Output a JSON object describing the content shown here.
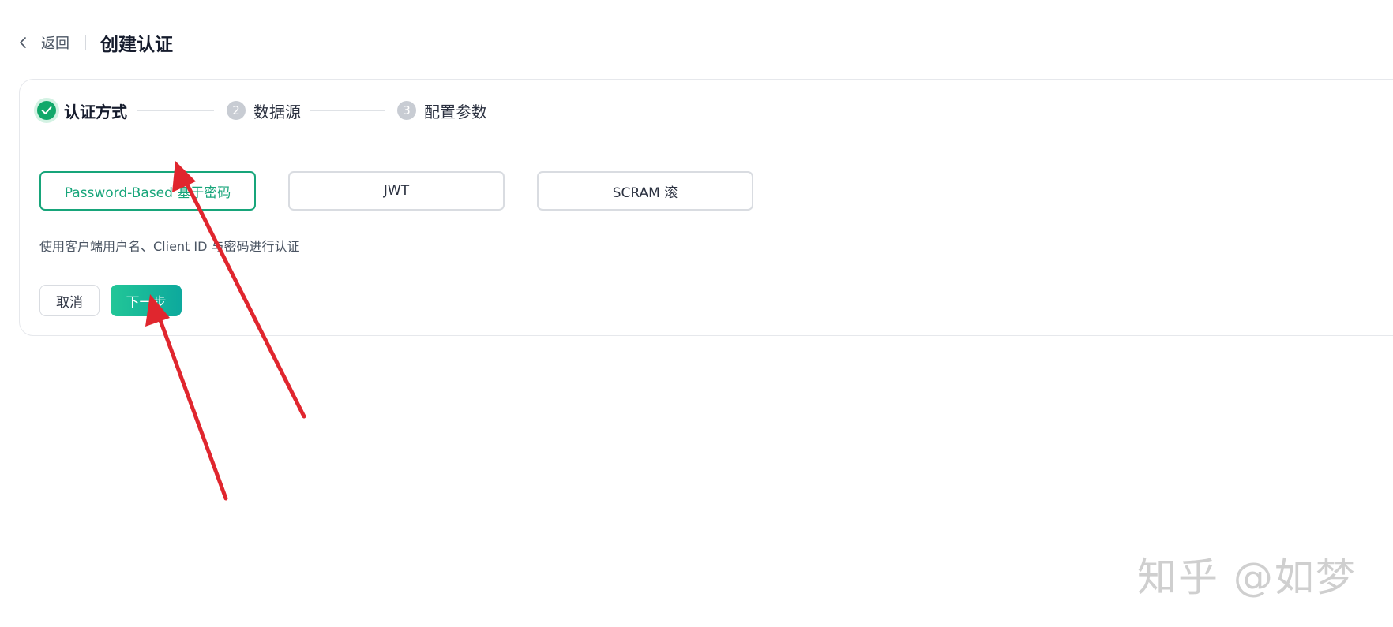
{
  "header": {
    "back_label": "返回",
    "title": "创建认证"
  },
  "stepper": {
    "steps": [
      {
        "number": "1",
        "label": "认证方式",
        "status": "done"
      },
      {
        "number": "2",
        "label": "数据源",
        "status": "pending"
      },
      {
        "number": "3",
        "label": "配置参数",
        "status": "pending"
      }
    ]
  },
  "auth_methods": {
    "options": [
      {
        "label": "Password-Based 基于密码",
        "selected": true
      },
      {
        "label": "JWT",
        "selected": false
      },
      {
        "label": "SCRAM 滚",
        "selected": false
      }
    ],
    "description": "使用客户端用户名、Client ID 与密码进行认证"
  },
  "actions": {
    "cancel_label": "取消",
    "next_label": "下一步"
  },
  "watermark": "知乎 @如梦",
  "colors": {
    "accent": "#17a57a",
    "step_done": "#12a86a",
    "step_pending": "#c8ccd3",
    "annotation_arrow": "#e0262e"
  },
  "icons": {
    "back": "chevron-left-icon",
    "step_done": "check-icon"
  }
}
